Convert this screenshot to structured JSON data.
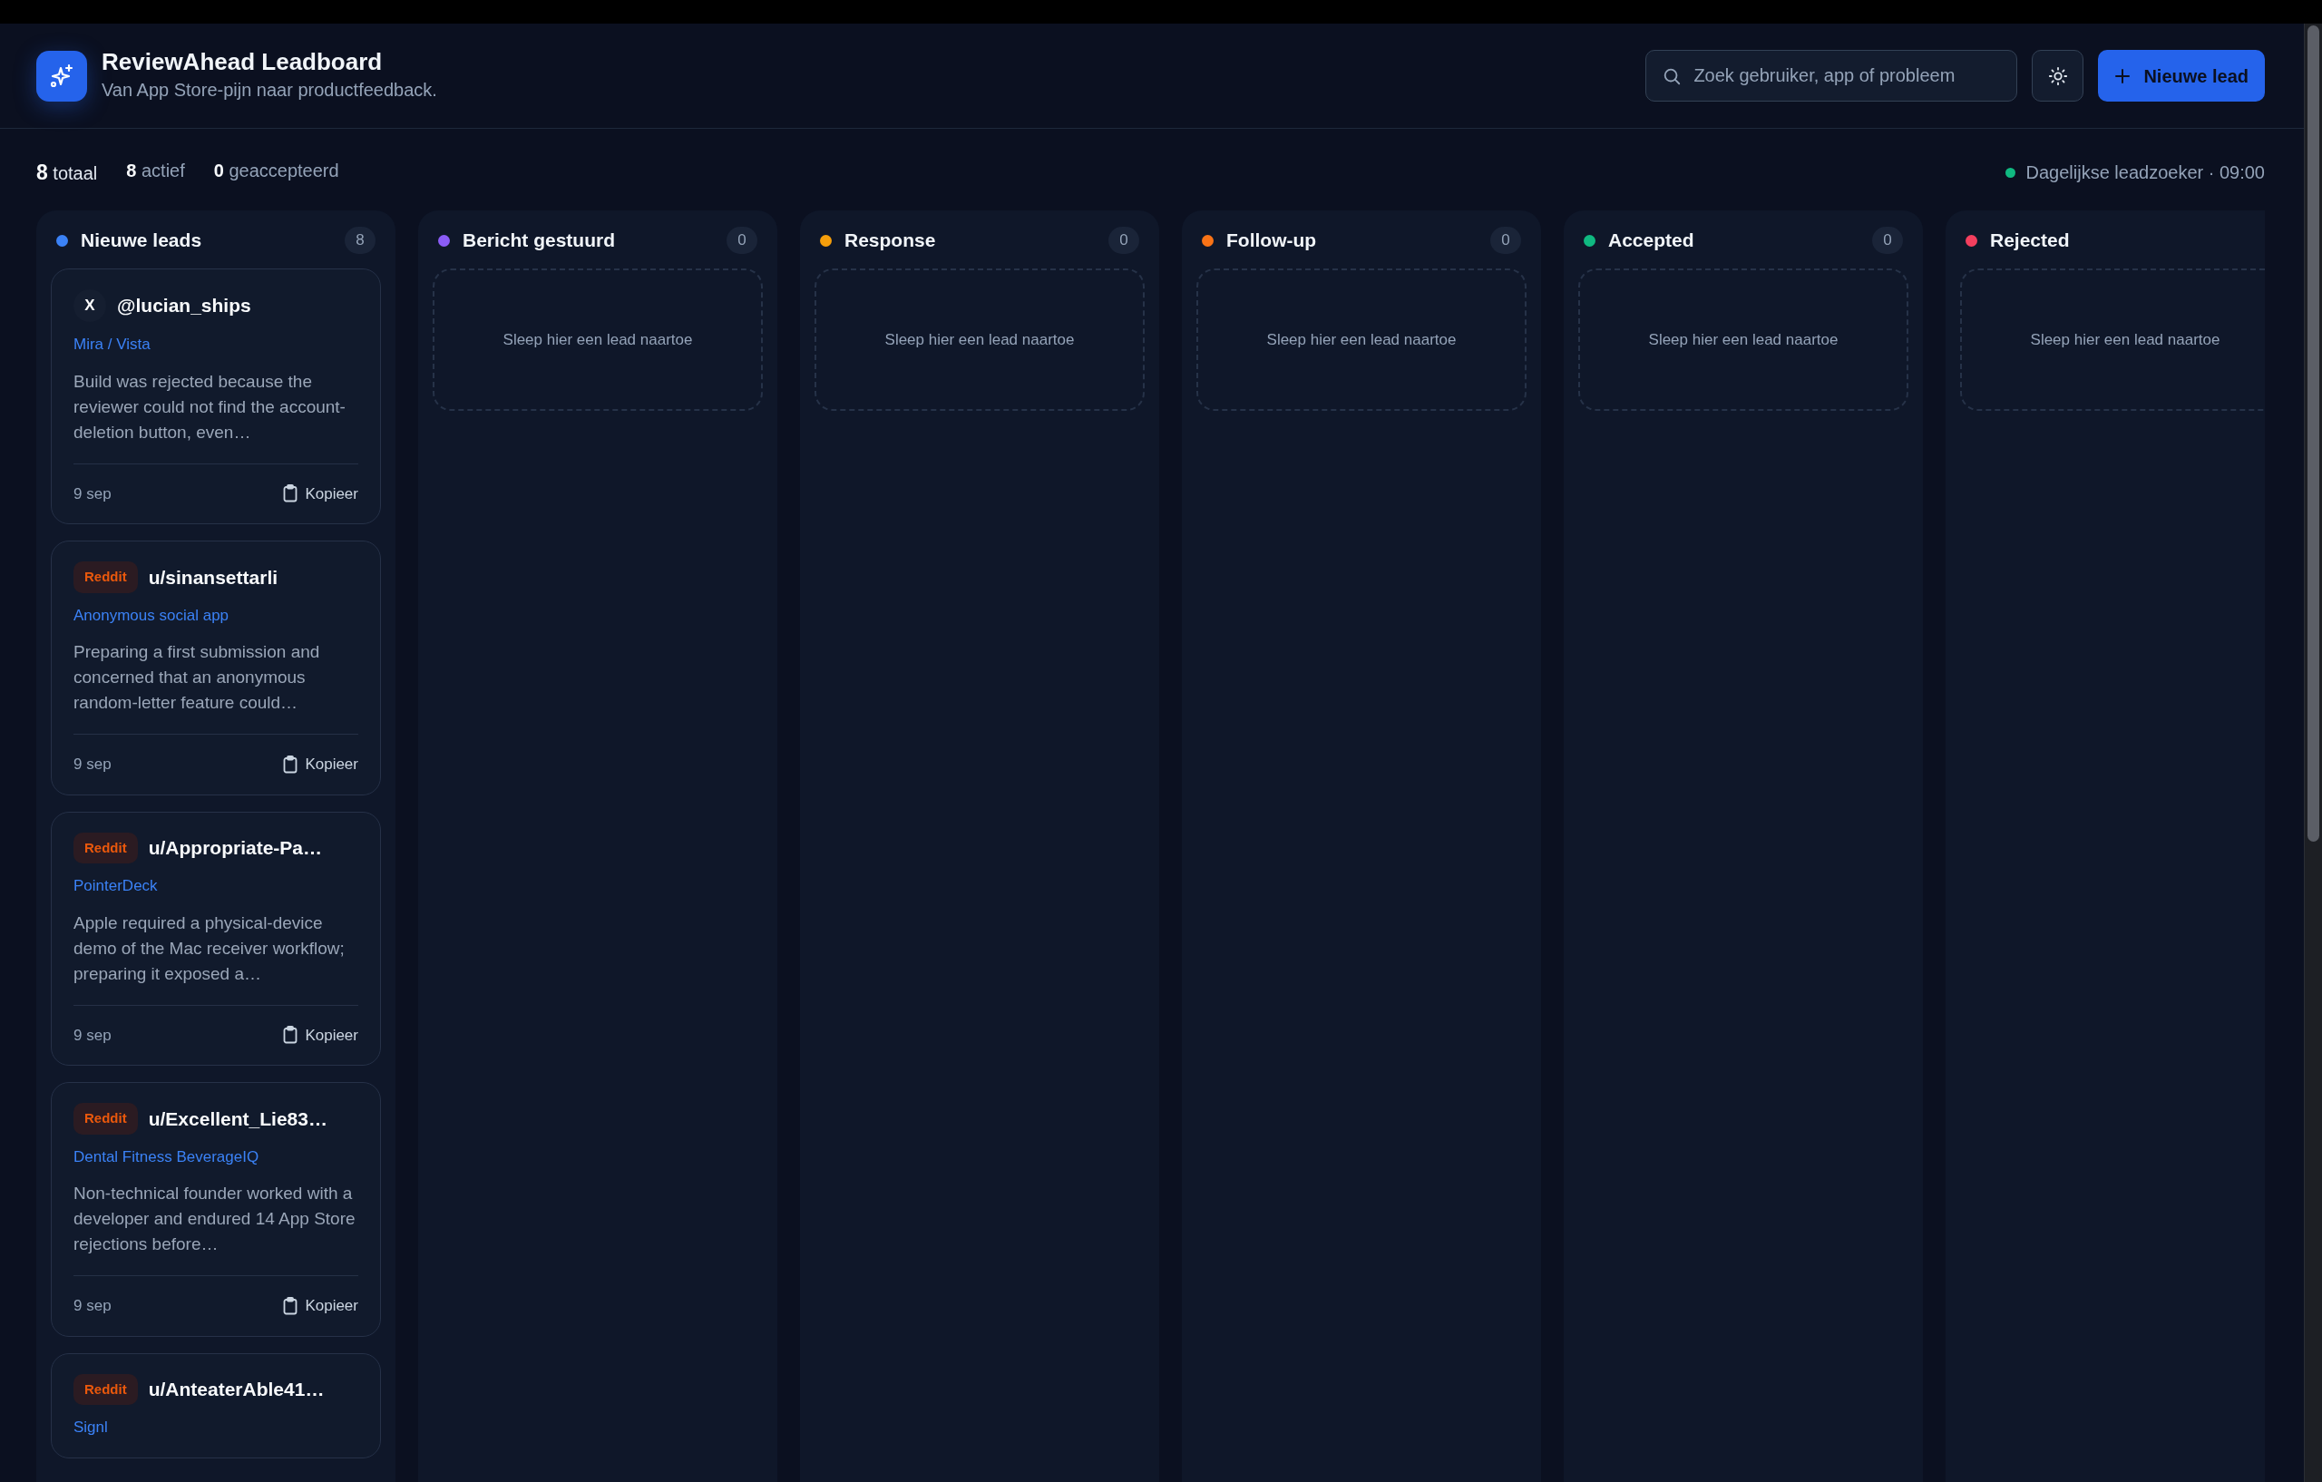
{
  "header": {
    "title": "ReviewAhead Leadboard",
    "subtitle": "Van App Store-pijn naar productfeedback.",
    "search": {
      "placeholder": "Zoek gebruiker, app of probleem"
    },
    "new_button": "Nieuwe lead"
  },
  "stats": [
    {
      "kind": "total",
      "text": "**8** totaal"
    },
    {
      "kind": "count",
      "text": "**8** actief"
    },
    {
      "kind": "count",
      "text": "**0** geaccepteerd"
    }
  ],
  "scheduler": "Dagelijkse leadzoeker · 09:00",
  "columns": [
    {
      "title": "Nieuwe leads",
      "color": "#3b82f6",
      "count": "8",
      "cards": [
        {
          "kind": "x",
          "badge": "X",
          "handle": "@lucian_ships",
          "app": "Mira / Vista",
          "summary": "Build was rejected because the reviewer could not find the account-deletion button, even…",
          "date": "9 sep",
          "copy": "Kopieer"
        },
        {
          "kind": "reddit",
          "badge": "Reddit",
          "handle": "u/sinansettarli",
          "app": "Anonymous social app",
          "summary": "Preparing a first submission and concerned that an anonymous random-letter feature could…",
          "date": "9 sep",
          "copy": "Kopieer"
        },
        {
          "kind": "reddit",
          "badge": "Reddit",
          "handle": "u/Appropriate-Pa…",
          "app": "PointerDeck",
          "summary": "Apple required a physical-device demo of the Mac receiver workflow; preparing it exposed a…",
          "date": "9 sep",
          "copy": "Kopieer"
        },
        {
          "kind": "reddit",
          "badge": "Reddit",
          "handle": "u/Excellent_Lie83…",
          "app": "Dental Fitness BeverageIQ",
          "summary": "Non-technical founder worked with a developer and endured 14 App Store rejections before…",
          "date": "9 sep",
          "copy": "Kopieer"
        },
        {
          "kind": "reddit",
          "badge": "Reddit",
          "handle": "u/AnteaterAble41…",
          "app": "Signl"
        }
      ]
    },
    {
      "title": "Bericht gestuurd",
      "color": "#8b5cf6",
      "count": "0",
      "empty": "Sleep hier een lead naartoe"
    },
    {
      "title": "Response",
      "color": "#f59e0b",
      "count": "0",
      "empty": "Sleep hier een lead naartoe"
    },
    {
      "title": "Follow-up",
      "color": "#f97316",
      "count": "0",
      "empty": "Sleep hier een lead naartoe"
    },
    {
      "title": "Accepted",
      "color": "#10b981",
      "count": "0",
      "empty": "Sleep hier een lead naartoe"
    },
    {
      "title": "Rejected",
      "color": "#f43f5e",
      "empty": "Sleep hier een lead naartoe"
    }
  ]
}
